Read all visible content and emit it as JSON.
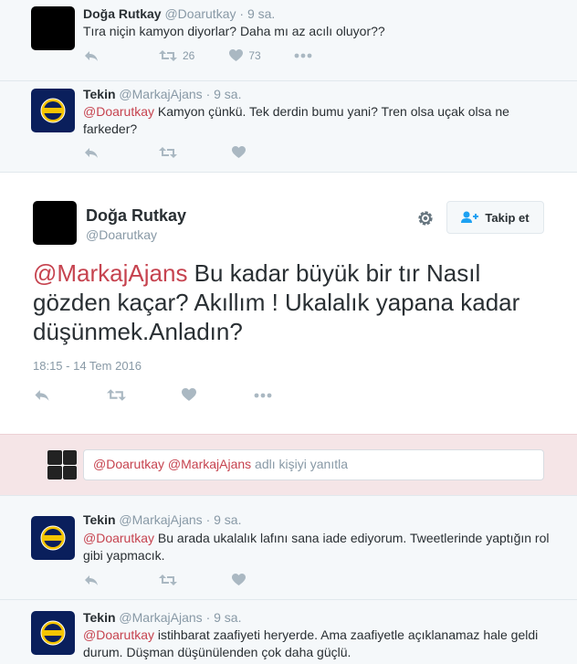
{
  "tweets_above": [
    {
      "name": "Doğa Rutkay",
      "handle": "@Doarutkay",
      "time": "· 9 sa.",
      "text": "Tıra niçin kamyon diyorlar? Daha mı az acılı oluyor??",
      "retweets": "26",
      "likes": "73"
    },
    {
      "name": "Tekin",
      "handle": "@MarkajAjans",
      "time": "· 9 sa.",
      "mention": "@Doarutkay",
      "text": " Kamyon çünkü. Tek derdin bumu yani?  Tren olsa uçak olsa ne farkeder?"
    }
  ],
  "main_tweet": {
    "name": "Doğa Rutkay",
    "handle": "@Doarutkay",
    "follow_label": "Takip et",
    "mention": "@MarkajAjans",
    "text": " Bu kadar büyük bir tır Nasıl gözden kaçar? Akıllım ! Ukalalık yapana kadar düşünmek.Anladın?",
    "timestamp": "18:15 - 14 Tem 2016"
  },
  "reply_box": {
    "mention1": "@Doarutkay",
    "mention2": "@MarkajAjans",
    "placeholder": " adlı kişiyi yanıtla"
  },
  "replies": [
    {
      "name": "Tekin",
      "handle": "@MarkajAjans",
      "time": "· 9 sa.",
      "mention": "@Doarutkay",
      "text": " Bu arada ukalalık lafını sana iade ediyorum. Tweetlerinde yaptığın rol gibi yapmacık."
    },
    {
      "name": "Tekin",
      "handle": "@MarkajAjans",
      "time": "· 9 sa.",
      "mention": "@Doarutkay",
      "text": " istihbarat zaafiyeti heryerde. Ama zaafiyetle açıklanamaz hale geldi durum. Düşman düşünülenden çok daha güçlü."
    }
  ],
  "icons": [
    "reply-icon",
    "retweet-icon",
    "heart-icon",
    "more-icon",
    "gear-icon",
    "follow-icon"
  ],
  "colors": {
    "mention": "#c6434f",
    "meta": "#8899a6",
    "action": "#aab8c2",
    "reply_bg": "#f5e5e7"
  }
}
